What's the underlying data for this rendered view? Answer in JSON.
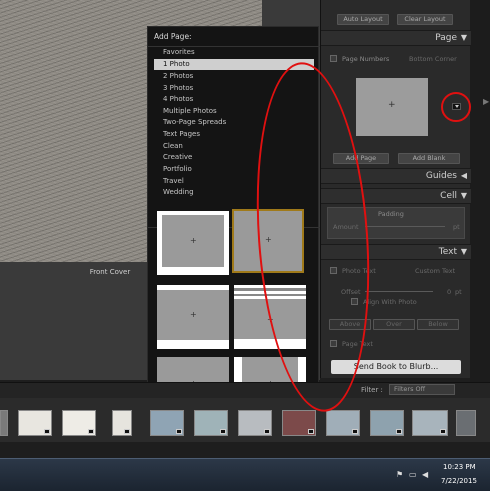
{
  "left_canvas": {
    "front_cover_label": "Front Cover"
  },
  "add_page_menu": {
    "title": "Add Page:",
    "items": [
      {
        "label": "Favorites",
        "selected": false
      },
      {
        "label": "1 Photo",
        "selected": true
      },
      {
        "label": "2 Photos",
        "selected": false
      },
      {
        "label": "3 Photos",
        "selected": false
      },
      {
        "label": "4 Photos",
        "selected": false
      },
      {
        "label": "Multiple Photos",
        "selected": false
      },
      {
        "label": "Two-Page Spreads",
        "selected": false
      },
      {
        "label": "Text Pages",
        "selected": false
      },
      {
        "label": "Clean",
        "selected": false
      },
      {
        "label": "Creative",
        "selected": false
      },
      {
        "label": "Portfolio",
        "selected": false
      },
      {
        "label": "Travel",
        "selected": false
      },
      {
        "label": "Wedding",
        "selected": false
      }
    ]
  },
  "right_panel": {
    "auto_layout_button": "Auto Layout",
    "clear_layout_button": "Clear Layout",
    "page_section": {
      "title": "Page",
      "page_numbers_label": "Page Numbers",
      "page_numbers_position": "Bottom Corner",
      "add_page_button": "Add Page",
      "add_blank_button": "Add Blank"
    },
    "guides_section": {
      "title": "Guides"
    },
    "cell_section": {
      "title": "Cell",
      "padding_label": "Padding",
      "amount_label": "Amount",
      "amount_unit": "pt"
    },
    "text_section": {
      "title": "Text",
      "photo_text_label": "Photo Text",
      "photo_text_value": "Custom Text",
      "offset_label": "Offset",
      "offset_value": "0",
      "offset_unit": "pt",
      "align_label": "Align With Photo",
      "align_buttons": [
        "Above",
        "Over",
        "Below"
      ],
      "page_text_label": "Page Text"
    },
    "send_button": "Send Book to Blurb..."
  },
  "filmstrip": {
    "filter_label": "Filter :",
    "filter_value": "Filters Off"
  },
  "taskbar": {
    "time": "10:23 PM",
    "date": "7/22/2015"
  }
}
